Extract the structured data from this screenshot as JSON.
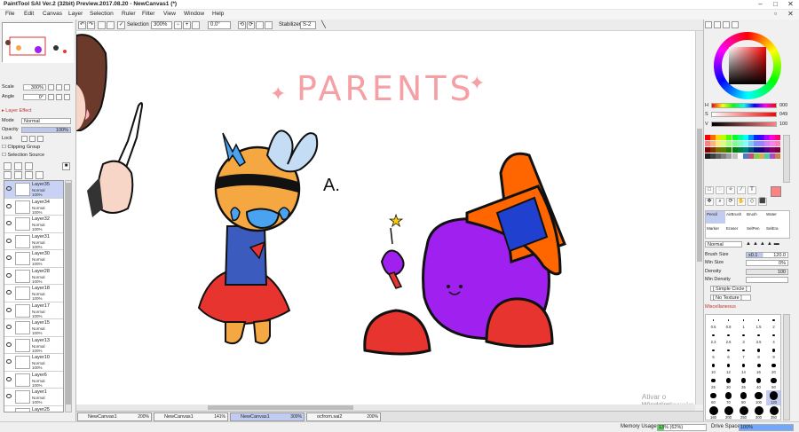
{
  "window": {
    "title": "PaintTool SAI Ver.2 (32bit) Preview.2017.08.20 - NewCanvas1 (*)"
  },
  "menu": [
    "File",
    "Edit",
    "Canvas",
    "Layer",
    "Selection",
    "Ruler",
    "Filter",
    "View",
    "Window",
    "Help"
  ],
  "toolbar": {
    "selection_label": "Selection",
    "zoom": "300%",
    "rotation": "0.0°",
    "stabilizer_label": "Stabilizer",
    "stabilizer_value": "S-2"
  },
  "navigator": {
    "scale_label": "Scale",
    "scale_value": "300%",
    "angle_label": "Angle",
    "angle_value": "0°"
  },
  "layer_panel": {
    "effect_label": "Layer Effect",
    "mode_label": "Mode",
    "mode_value": "Normal",
    "opacity_label": "Opacity",
    "opacity_value": "100%",
    "lock_label": "Lock",
    "clipping_group": "Clipping Group",
    "selection_source": "Selection Source",
    "layers": [
      {
        "name": "Layer35",
        "mode": "Normal",
        "opacity": "100%",
        "selected": true
      },
      {
        "name": "Layer34",
        "mode": "Normal",
        "opacity": "100%"
      },
      {
        "name": "Layer32",
        "mode": "Normal",
        "opacity": "100%"
      },
      {
        "name": "Layer31",
        "mode": "Normal",
        "opacity": "100%"
      },
      {
        "name": "Layer30",
        "mode": "Normal",
        "opacity": "100%"
      },
      {
        "name": "Layer28",
        "mode": "Normal",
        "opacity": "100%"
      },
      {
        "name": "Layer18",
        "mode": "Normal",
        "opacity": "100%"
      },
      {
        "name": "Layer17",
        "mode": "Normal",
        "opacity": "100%"
      },
      {
        "name": "Layer15",
        "mode": "Normal",
        "opacity": "100%"
      },
      {
        "name": "Layer13",
        "mode": "Normal",
        "opacity": "100%"
      },
      {
        "name": "Layer10",
        "mode": "Normal",
        "opacity": "100%"
      },
      {
        "name": "Layer6",
        "mode": "Normal",
        "opacity": "100%"
      },
      {
        "name": "Layer1",
        "mode": "Normal",
        "opacity": "100%"
      },
      {
        "name": "Layer25",
        "mode": "Normal",
        "opacity": "100%"
      }
    ]
  },
  "canvas": {
    "heading": "PARENTS",
    "annotation": "A."
  },
  "color": {
    "h_label": "H",
    "h_value": "000",
    "s_label": "S",
    "s_value": "049",
    "v_label": "V",
    "v_value": "100",
    "current_color": "#ff8282",
    "swatches": [
      "#ff0000",
      "#ff6a00",
      "#ffd800",
      "#b6ff00",
      "#4cff00",
      "#00ff21",
      "#00ff90",
      "#00ffff",
      "#0094ff",
      "#0026ff",
      "#4800ff",
      "#b200ff",
      "#ff00dc",
      "#ff006e",
      "#ff8080",
      "#ffb27f",
      "#ffe97f",
      "#daff7f",
      "#a5ff7f",
      "#7fff8e",
      "#7fffc5",
      "#7fffff",
      "#7fc9ff",
      "#7f92ff",
      "#a17fff",
      "#d67fff",
      "#ff7fed",
      "#ff7fb6",
      "#7f0000",
      "#7f3300",
      "#7f6a00",
      "#5b7f00",
      "#267f00",
      "#007f0e",
      "#007f46",
      "#007f7f",
      "#004a7f",
      "#00137f",
      "#21007f",
      "#57007f",
      "#7f006e",
      "#7f0037",
      "#202020",
      "#404040",
      "#606060",
      "#808080",
      "#a0a0a0",
      "#c0c0c0",
      "#ffffff",
      "#4a7fd0",
      "#d04a7f",
      "#7fd04a",
      "#d0b04a",
      "#4ad0b0",
      "#b04ad0",
      "#d07f4a"
    ]
  },
  "tools": {
    "pencil": "Pencil",
    "airbrush": "AirBrush",
    "brush": "Brush",
    "water": "Water",
    "marker": "Marker",
    "eraser": "Eraser",
    "selpen": "SelPen",
    "seler": "SelEra"
  },
  "brush": {
    "mode": "Normal",
    "size_label": "Brush Size",
    "size_mult": "x0.1",
    "size_value": "120.0",
    "min_size_label": "Min Size",
    "min_size_value": "0%",
    "density_label": "Density",
    "density_value": "100",
    "min_density_label": "Min Density",
    "shape": "[ Simple Circle ]",
    "texture": "[ No Texture ]",
    "misc_label": "Miscellaneous",
    "sizes": [
      "0.6",
      "0.8",
      "1",
      "1.5",
      "2",
      "2.3",
      "2.6",
      "3",
      "3.5",
      "4",
      "5",
      "6",
      "7",
      "8",
      "9",
      "10",
      "12",
      "14",
      "16",
      "20",
      "25",
      "30",
      "35",
      "40",
      "50",
      "60",
      "70",
      "80",
      "100",
      "120",
      "160",
      "200",
      "250",
      "300",
      "350"
    ],
    "selected_size": "120"
  },
  "tabs": [
    {
      "name": "NewCanvas1",
      "zoom": "200%"
    },
    {
      "name": "NewCanvas1",
      "zoom": "141%"
    },
    {
      "name": "NewCanvas1",
      "zoom": "300%",
      "active": true
    },
    {
      "name": "ocfrom.sai2",
      "zoom": "200%"
    }
  ],
  "status": {
    "memory_label": "Memory Usage",
    "memory_value": "13% (62%)",
    "drive_label": "Drive Space",
    "drive_value": "100%"
  },
  "watermark": {
    "line1": "Ativar o Windows",
    "line2": "Acesse Configurações"
  }
}
